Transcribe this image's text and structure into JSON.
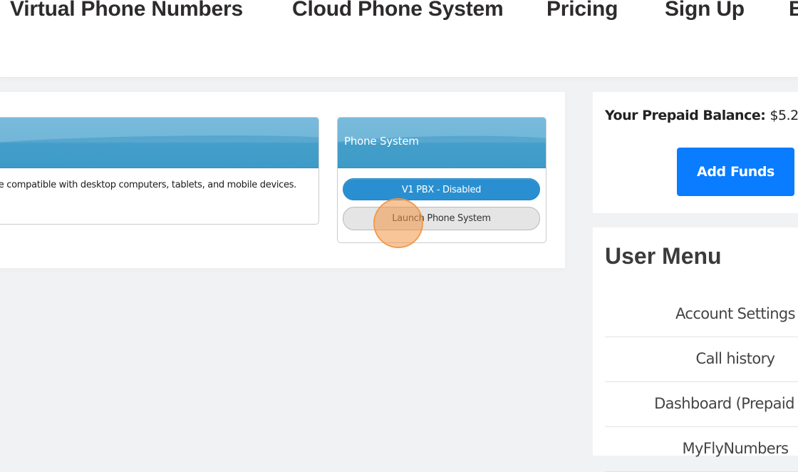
{
  "nav": {
    "items": [
      {
        "label": "Virtual Phone Numbers"
      },
      {
        "label": "Cloud Phone System"
      },
      {
        "label": "Pricing"
      },
      {
        "label": "Sign Up"
      },
      {
        "label": "B"
      }
    ]
  },
  "main": {
    "left_card": {
      "body_text": "e compatible with desktop computers, tablets, and mobile devices."
    },
    "phone_card": {
      "title": "Phone System",
      "status_button": "V1 PBX - Disabled",
      "launch_button": "Launch Phone System"
    }
  },
  "balance": {
    "label": "Your Prepaid Balance:",
    "amount": "$5.2",
    "add_funds_label": "Add Funds"
  },
  "user_menu": {
    "title": "User Menu",
    "items": [
      {
        "label": "Account Settings"
      },
      {
        "label": "Call history"
      },
      {
        "label": "Dashboard (Prepaid ba"
      },
      {
        "label": "MyFlyNumbers"
      }
    ]
  },
  "colors": {
    "accent_blue": "#0a7cff",
    "pill_blue": "#2a8fd0",
    "header_blue": "#3d9bc7",
    "click_indicator": "#f39646"
  }
}
